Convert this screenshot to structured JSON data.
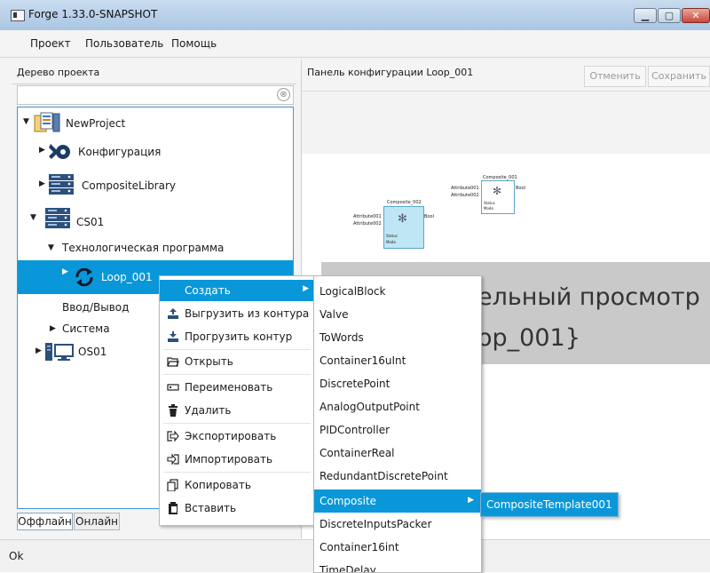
{
  "window": {
    "title": "Forge 1.33.0-SNAPSHOT",
    "min": "▁",
    "max": "▢",
    "close": "✕"
  },
  "menubar": [
    "Проект",
    "Пользователь",
    "Помощь"
  ],
  "left": {
    "title": "Дерево проекта",
    "search_value": "",
    "clear_icon": "⊗",
    "tree": [
      {
        "label": "NewProject",
        "icon": "project-icon"
      },
      {
        "label": "Конфигурация",
        "icon": "wrench-gear-icon"
      },
      {
        "label": "CompositeLibrary",
        "icon": "server-rack-icon"
      },
      {
        "label": "CS01",
        "icon": "server-rack-icon"
      },
      {
        "label": "Технологическая программа"
      },
      {
        "label": "Loop_001",
        "icon": "loop-icon"
      },
      {
        "label": "Ввод/Вывод"
      },
      {
        "label": "Система"
      },
      {
        "label": "OS01",
        "icon": "workstation-icon"
      }
    ],
    "tabs": [
      "Оффлайн",
      "Онлайн"
    ]
  },
  "right": {
    "title": "Панель конфигурации Loop_001",
    "cancel": "Отменить",
    "save": "Сохранить",
    "preview_line1": "ельный просмотр",
    "preview_line2": "op_001}",
    "comp1": {
      "title": "Composite_001",
      "in1": "Attribute001",
      "in2": "Attribute002",
      "out": "Bool",
      "status": "Status",
      "mode": "Mode"
    },
    "comp2": {
      "title": "Composite_002",
      "in1": "Attribute001",
      "in2": "Attribute002",
      "out": "Bool",
      "status": "Status",
      "mode": "Mode"
    }
  },
  "status": {
    "text": "Ok"
  },
  "context_menu": [
    {
      "label": "Создать",
      "icon": "",
      "submenu": true
    },
    {
      "label": "Выгрузить из контура",
      "icon": "unload-icon"
    },
    {
      "label": "Прогрузить контур",
      "icon": "load-icon"
    },
    {
      "label": "Открыть",
      "icon": "folder-open-icon"
    },
    {
      "label": "Переименовать",
      "icon": "rename-icon"
    },
    {
      "label": "Удалить",
      "icon": "trash-icon"
    },
    {
      "label": "Экспортировать",
      "icon": "export-icon"
    },
    {
      "label": "Импортировать",
      "icon": "import-icon"
    },
    {
      "label": "Копировать",
      "icon": "copy-icon"
    },
    {
      "label": "Вставить",
      "icon": "paste-icon"
    }
  ],
  "create_submenu": [
    "LogicalBlock",
    "Valve",
    "ToWords",
    "Container16uInt",
    "DiscretePoint",
    "AnalogOutputPoint",
    "PIDController",
    "ContainerReal",
    "RedundantDiscretePoint",
    "Composite",
    "DiscreteInputsPacker",
    "Container16int",
    "TimeDelay"
  ],
  "composite_submenu": [
    "CompositeTemplate001"
  ],
  "submenu_arrow": "▶",
  "colors": {
    "accent": "#0a97d9",
    "preview_bg": "#c9c9c9"
  }
}
